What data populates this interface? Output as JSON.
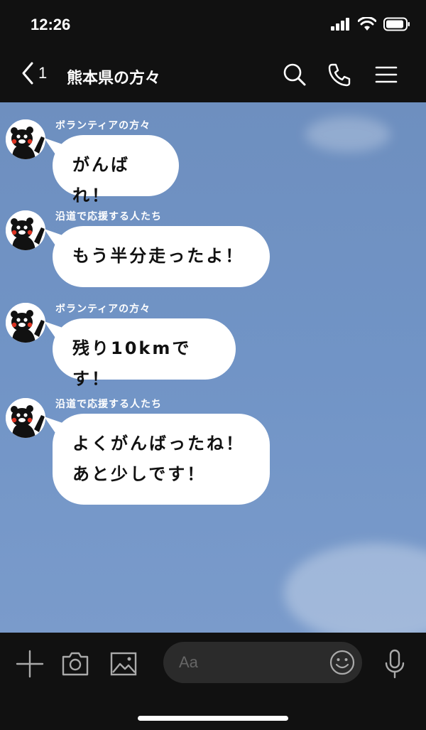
{
  "status_bar": {
    "time": "12:26"
  },
  "header": {
    "back_count": "1",
    "title": "熊本県の方々"
  },
  "messages": [
    {
      "sender": "ボランティアの方々",
      "lines": [
        "がんばれ！"
      ]
    },
    {
      "sender": "沿道で応援する人たち",
      "lines": [
        "もう半分走ったよ！"
      ]
    },
    {
      "sender": "ボランティアの方々",
      "lines": [
        "残り10kmです！"
      ]
    },
    {
      "sender": "沿道で応援する人たち",
      "lines": [
        "よくがんばったね！",
        "あと少しです！"
      ]
    }
  ],
  "input": {
    "placeholder": "Aa"
  },
  "colors": {
    "chat_background": "#7194c6",
    "bars": "#111111",
    "bubble": "#ffffff"
  }
}
